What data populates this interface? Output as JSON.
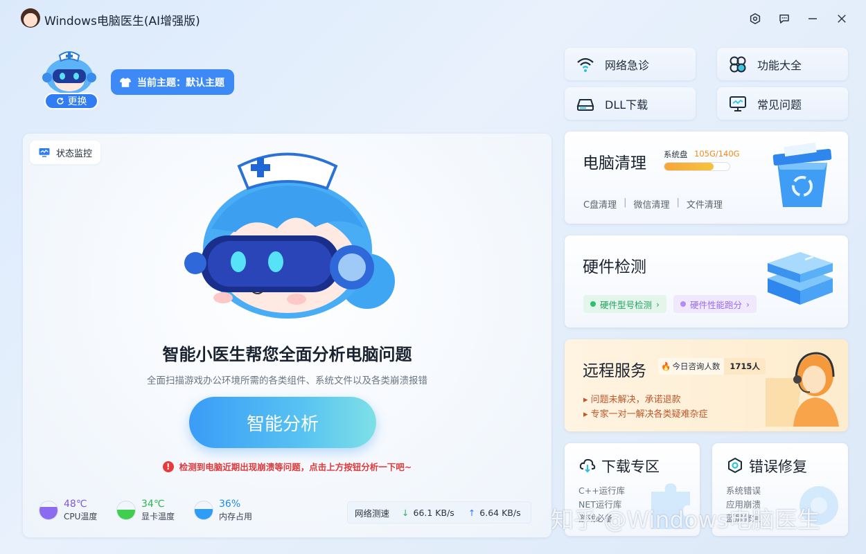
{
  "window": {
    "title": "Windows电脑医生(AI增强版)",
    "controls": [
      "settings",
      "feedback",
      "minimize",
      "close"
    ]
  },
  "theme": {
    "swap_label": "更换",
    "current_label": "当前主题：默认主题"
  },
  "main": {
    "status_chip": "状态监控",
    "headline": "智能小医生帮您全面分析电脑问题",
    "subline": "全面扫描游戏办公环境所需的各类组件、系统文件以及各类崩溃报错",
    "analyze_button": "智能分析",
    "warning": "检测到电脑近期出现崩溃等问题，点击上方按钮分析一下吧~",
    "gauges": [
      {
        "value": "48℃",
        "label": "CPU温度",
        "fill": 0.48,
        "color": "#8b6cf0",
        "value_color": "#7a5be0"
      },
      {
        "value": "34℃",
        "label": "显卡温度",
        "fill": 0.34,
        "color": "#3fce4d",
        "value_color": "#2fb44d"
      },
      {
        "value": "36%",
        "label": "内存占用",
        "fill": 0.36,
        "color": "#2f9cf5",
        "value_color": "#1e8ae6"
      }
    ],
    "net": {
      "label": "网络测速",
      "down": "66.1 KB/s",
      "up": "6.64 KB/s"
    }
  },
  "quick": {
    "net_diag": "网络急诊",
    "features": "功能大全",
    "dll": "DLL下载",
    "faq": "常见问题"
  },
  "cleanup": {
    "title": "电脑清理",
    "disk_label": "系统盘",
    "disk_value": "105G/140G",
    "disk_ratio": 0.75,
    "links": [
      "C盘清理",
      "微信清理",
      "文件清理"
    ]
  },
  "hardware": {
    "title": "硬件检测",
    "tag1": "硬件型号检测",
    "tag2": "硬件性能跑分"
  },
  "remote": {
    "title": "远程服务",
    "badge_label": "今日咨询人数",
    "badge_value": "1715人",
    "bullet1": "问题未解决，承诺退款",
    "bullet2": "专家一对一解决各类疑难杂症"
  },
  "download": {
    "title": "下载专区",
    "items": [
      "C++运行库",
      "NET运行库",
      "游戏必备"
    ]
  },
  "repair": {
    "title": "错误修复",
    "items": [
      "系统错误",
      "应用崩溃",
      "蓝屏修复"
    ]
  },
  "watermark": "知乎 @Windows电脑医生"
}
